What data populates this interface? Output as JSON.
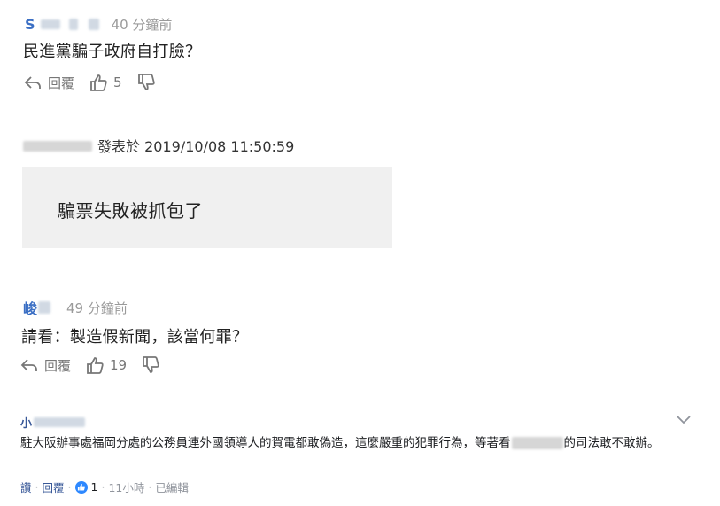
{
  "comment1": {
    "time": "40 分鐘前",
    "text": "民進黨騙子政府自打臉？",
    "reply_label": "回覆",
    "likes": "5"
  },
  "comment2": {
    "posted_label": "發表於 2019/10/08 11:50:59",
    "text": "騙票失敗被抓包了"
  },
  "comment3": {
    "user_prefix": "峻",
    "time": "49 分鐘前",
    "text": "請看：製造假新聞，該當何罪？",
    "reply_label": "回覆",
    "likes": "19"
  },
  "comment4": {
    "user_prefix": "小",
    "text_before": "駐大阪辦事處福岡分處的公務員連外國領導人的賀電都敢偽造，這麼嚴重的犯罪行為，等著看",
    "text_after": "的司法敢不敢辦。",
    "like_label": "讚",
    "reply_label": "回覆",
    "reaction_count": "1",
    "age": "11小時",
    "edited": "已編輯"
  },
  "colors": {
    "username_blue": "#3b6fc4",
    "fb_blue": "#385898",
    "like_badge": "#2d88ff",
    "quote_bg": "#f0f0f0"
  }
}
